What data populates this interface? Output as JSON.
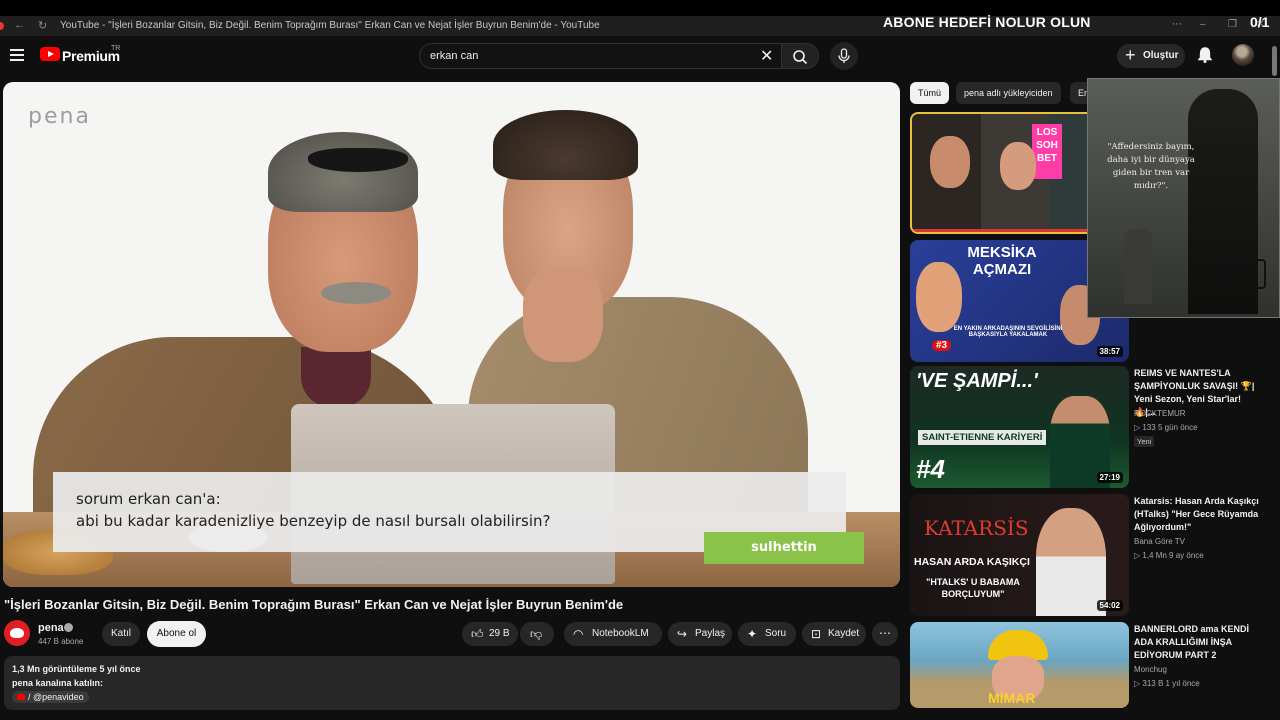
{
  "browser": {
    "tab_title": "YouTube - \"İşleri Bozanlar Gitsin, Biz Değil. Benim Toprağım Burası\" Erkan Can ve Nejat İşler Buyrun Benim'de - YouTube"
  },
  "overlay": {
    "goal_text": "ABONE HEDEFİ NOLUR OLUN",
    "counter": "0/1"
  },
  "header": {
    "brand": "Premium",
    "country": "TR",
    "search_value": "erkan can",
    "create_label": "Oluştur"
  },
  "player": {
    "watermark": "pena",
    "caption_line1": "sorum erkan can'a:",
    "caption_line2": "abi bu kadar karadenizliye benzeyip de nasıl bursalı olabilirsin?",
    "caption_name": "sulhettin"
  },
  "video": {
    "title": "\"İşleri Bozanlar Gitsin, Biz Değil. Benim Toprağım Burası\" Erkan Can ve Nejat İşler Buyrun Benim'de",
    "channel_name": "pena",
    "subscribers": "447 B abone",
    "join_label": "Katıl",
    "subscribe_label": "Abone ol",
    "likes": "29 B",
    "notebook_label": "NotebookLM",
    "share_label": "Paylaş",
    "ask_label": "Soru",
    "save_label": "Kaydet",
    "more_icon": "⋯"
  },
  "description": {
    "stats": "1,3 Mn görüntüleme  5 yıl önce",
    "join_text": "pena kanalına katılın:",
    "handle": "/ @penavideo"
  },
  "filters": {
    "chips": [
      "Tümü",
      "pena adlı yükleyiciden",
      "En"
    ]
  },
  "pip": {
    "quote": "\"Affedersiniz bayım, daha iyi bir dünyaya giden bir tren var mıdır?\"."
  },
  "recommendations": [
    {
      "thumb_text": "LOS SOH BET",
      "duration": ""
    },
    {
      "thumb_text": "MEKSİKA AÇMAZI",
      "thumb_sub": "EN YAKIN ARKADAŞININ SEVGİLİSİNİ BAŞKASIYLA YAKALAMAK",
      "thumb_num": "#3",
      "duration": "38:57"
    },
    {
      "thumb_text": "'VE ŞAMPİ...'",
      "thumb_sub": "SAINT-ETIENNE KARİYERİ",
      "thumb_num": "#4",
      "duration": "27:19",
      "title": "REIMS VE NANTES'LA ŞAMPİYONLUK SAVAŞI! 🏆| Yeni Sezon, Yeni Star'lar! 🔥|...",
      "channel": "ROCKTEMUR",
      "stats": "▷ 133   5 gün önce",
      "badge": "Yeni"
    },
    {
      "thumb_text": "KATARSİS",
      "thumb_sub": "HASAN ARDA KAŞIKÇI",
      "thumb_quote": "\"HTALKS' U BABAMA BORÇLUYUM\"",
      "duration": "54:02",
      "title": "Katarsis: Hasan Arda Kaşıkçı (HTalks) \"Her Gece Rüyamda Ağlıyordum!\"",
      "channel": "Bana Göre TV",
      "stats": "▷ 1,4 Mn   9 ay önce"
    },
    {
      "thumb_text": "MİMAR",
      "title": "BANNERLORD ama KENDİ ADA KRALLIĞIMI İNŞA EDİYORUM PART 2",
      "channel": "Monchug",
      "stats": "▷ 313 B   1 yıl önce"
    }
  ]
}
